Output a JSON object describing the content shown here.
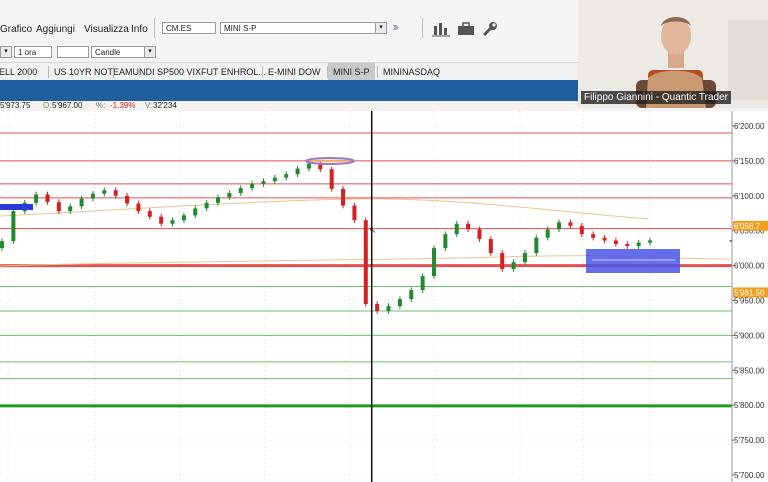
{
  "menu": {
    "items": [
      "Grafico",
      "Aggiungi",
      "Visualizza",
      "Info"
    ]
  },
  "symbol": {
    "code": "CM.ES",
    "name": "MINI S-P"
  },
  "toolbar": {
    "timeframe": "1 ora",
    "style": "Candle"
  },
  "tabs": [
    {
      "label": "ELL 2000",
      "active": false
    },
    {
      "label": "US 10YR NOTE",
      "active": false
    },
    {
      "label": "AMUNDI SP500 VIXFUT ENHROL...",
      "active": false
    },
    {
      "label": "E-MINI DOW",
      "active": false
    },
    {
      "label": "MINI S-P",
      "active": true
    },
    {
      "label": "MININASDAQ",
      "active": false
    }
  ],
  "quote": {
    "high": "5'973.75",
    "open_label": "O:",
    "open": "5'967.00",
    "change_label": "%:",
    "change": "-1.39%",
    "volume_label": "V:",
    "volume": "32'234"
  },
  "webcam": {
    "caption": "Filippo Giannini - Quantic Trader"
  },
  "colors": {
    "up": "#1f8a2e",
    "down": "#d42020",
    "accent": "#1f5f9f",
    "support": "#2aa02a",
    "resistance": "#e25050"
  },
  "chart_data": {
    "type": "candlestick",
    "y_ticks": [
      "6'200.00",
      "6'150.00",
      "6'100.00",
      "6'050.00",
      "6'000.00",
      "5'950.00",
      "5'900.00",
      "5'850.00",
      "5'800.00",
      "5'750.00",
      "5'700.00"
    ],
    "ylim": [
      5700,
      6200
    ],
    "price_labels": [
      {
        "text": "6'056.7",
        "value": 6057,
        "color": "#f0a020"
      },
      {
        "text": "5'961.50",
        "value": 5961.5,
        "color": "#f0a020"
      }
    ],
    "horizontal_levels": [
      {
        "value": 6190,
        "color": "#e25050",
        "weight": 1
      },
      {
        "value": 6150,
        "color": "#e25050",
        "weight": 1
      },
      {
        "value": 6117,
        "color": "#e25050",
        "weight": 1
      },
      {
        "value": 6097,
        "color": "#e25050",
        "weight": 1
      },
      {
        "value": 6053,
        "color": "#e25050",
        "weight": 1
      },
      {
        "value": 6000,
        "color": "#e25050",
        "weight": 3
      },
      {
        "value": 5970,
        "color": "#6cc06c",
        "weight": 1
      },
      {
        "value": 5935,
        "color": "#6cc06c",
        "weight": 1
      },
      {
        "value": 5900,
        "color": "#6cc06c",
        "weight": 1
      },
      {
        "value": 5862,
        "color": "#6cc06c",
        "weight": 1
      },
      {
        "value": 5838,
        "color": "#6cc06c",
        "weight": 1
      },
      {
        "value": 5799,
        "color": "#1e9a1e",
        "weight": 3
      }
    ],
    "series": [
      {
        "name": "close",
        "values": [
          6035,
          6078,
          6090,
          6102,
          6091,
          6078,
          6085,
          6096,
          6103,
          6108,
          6100,
          6089,
          6078,
          6070,
          6060,
          6065,
          6072,
          6082,
          6090,
          6098,
          6104,
          6111,
          6117,
          6121,
          6126,
          6131,
          6139,
          6146,
          6138,
          6110,
          6086,
          6065,
          5945,
          5935,
          5942,
          5952,
          5965,
          5985,
          6025,
          6045,
          6060,
          6052,
          6038,
          6018,
          5995,
          6005,
          6018,
          6040,
          6052,
          6062,
          6057,
          6045,
          6040,
          6036,
          6031,
          6028,
          6033,
          6036
        ]
      }
    ],
    "cursor_x": 0.484
  }
}
